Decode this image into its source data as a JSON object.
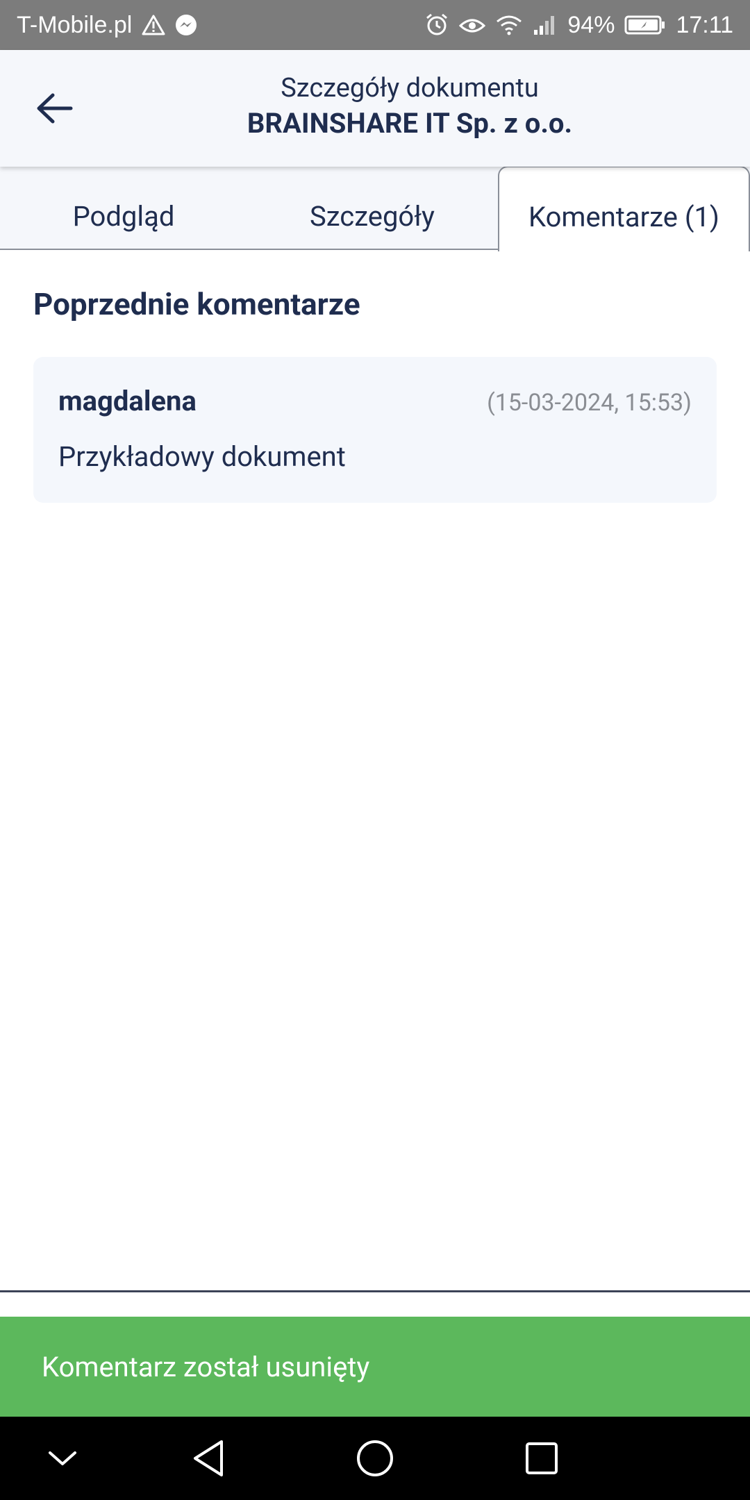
{
  "status_bar": {
    "carrier": "T-Mobile.pl",
    "battery": "94%",
    "time": "17:11"
  },
  "header": {
    "subtitle": "Szczegóły dokumentu",
    "title": "BRAINSHARE IT Sp. z o.o."
  },
  "tabs": [
    {
      "label": "Podgląd",
      "active": false
    },
    {
      "label": "Szczegóły",
      "active": false
    },
    {
      "label": "Komentarze (1)",
      "active": true
    }
  ],
  "comments_section": {
    "title": "Poprzednie komentarze",
    "items": [
      {
        "author": "magdalena",
        "date": "(15-03-2024, 15:53)",
        "text": "Przykładowy dokument"
      }
    ]
  },
  "snackbar": {
    "message": "Komentarz został usunięty"
  },
  "colors": {
    "primary_text": "#1f2d4f",
    "header_bg": "#f5f7fb",
    "snackbar_bg": "#5cb85c",
    "status_bar_bg": "#7c7c7c"
  }
}
